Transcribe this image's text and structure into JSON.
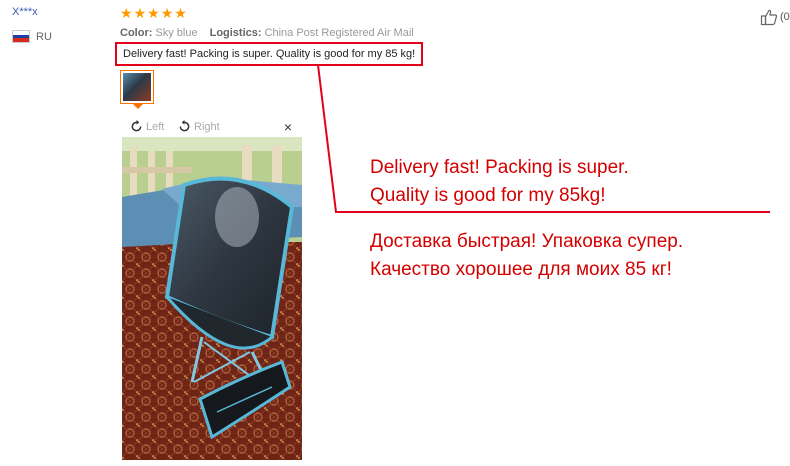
{
  "reviewer": {
    "name": "X***x",
    "country_code": "RU"
  },
  "rating": {
    "stars": 5
  },
  "meta": {
    "color_label": "Color:",
    "color_value": "Sky blue",
    "logistics_label": "Logistics:",
    "logistics_value": "China Post Registered Air Mail"
  },
  "review": {
    "text": "Delivery fast! Packing is super. Quality is good for my 85 kg!"
  },
  "viewer": {
    "left_label": "Left",
    "right_label": "Right",
    "close_symbol": "×"
  },
  "overlay": {
    "en_line1": "Delivery fast! Packing is super.",
    "en_line2": "Quality is good for my 85kg!",
    "ru_line1": "Доставка быстрая! Упаковка супер.",
    "ru_line2": "Качество хорошее для моих 85 кг!"
  },
  "helpful": {
    "count_text": "(0"
  },
  "colors": {
    "highlight": "#e3001b",
    "star": "#ff9900",
    "thumb_border": "#ff7300"
  }
}
